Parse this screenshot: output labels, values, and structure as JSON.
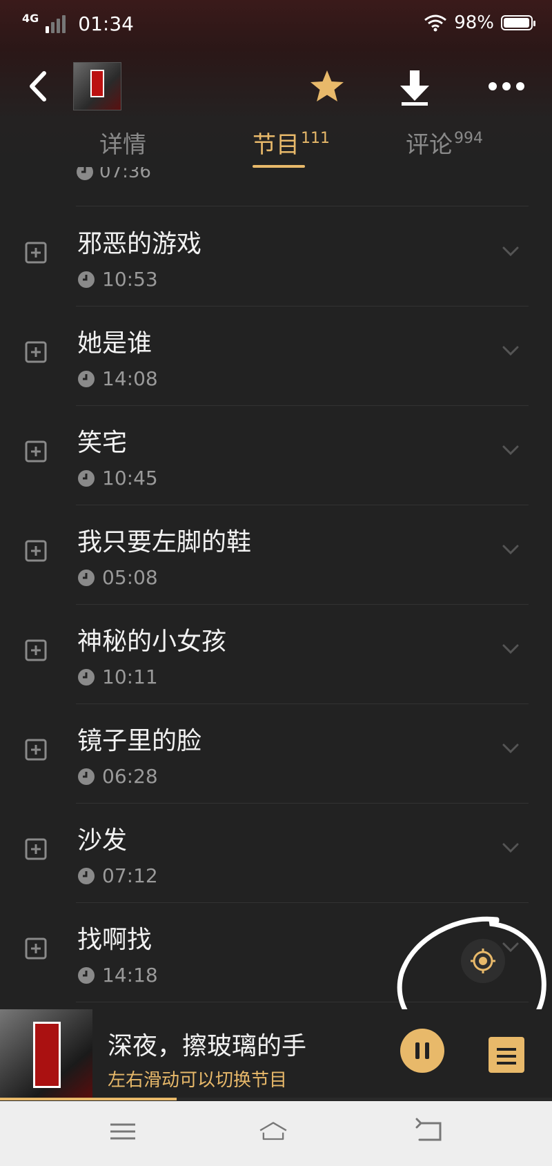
{
  "status_bar": {
    "network": "4G",
    "time": "01:34",
    "battery_percent": "98%",
    "battery_level": 0.98
  },
  "header": {
    "icons": [
      "back-arrow-icon",
      "album-cover",
      "star-icon",
      "download-icon",
      "more-icon"
    ],
    "tabs": [
      {
        "label": "详情",
        "count": ""
      },
      {
        "label": "节目",
        "count": "111"
      },
      {
        "label": "评论",
        "count": "994"
      }
    ],
    "active_tab": "节目"
  },
  "list": {
    "partial_top_duration": "07:36",
    "items": [
      {
        "title": "邪恶的游戏",
        "duration": "10:53"
      },
      {
        "title": "她是谁",
        "duration": "14:08"
      },
      {
        "title": "笑宅",
        "duration": "10:45"
      },
      {
        "title": "我只要左脚的鞋",
        "duration": "05:08"
      },
      {
        "title": "神秘的小女孩",
        "duration": "10:11"
      },
      {
        "title": "镜子里的脸",
        "duration": "06:28"
      },
      {
        "title": "沙发",
        "duration": "07:12"
      },
      {
        "title": "找啊找",
        "duration": "14:18"
      }
    ]
  },
  "player": {
    "title": "深夜，擦玻璃的手",
    "hint": "左右滑动可以切换节目",
    "progress": 0.32,
    "state": "playing"
  },
  "colors": {
    "accent": "#e8b96a",
    "background": "#222222",
    "muted_text": "#9a9a9a"
  }
}
